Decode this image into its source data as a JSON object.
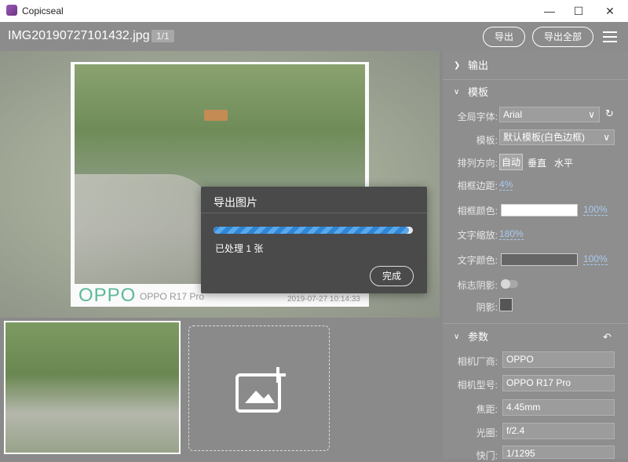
{
  "window": {
    "title": "Copicseal",
    "minimize": "—",
    "maximize": "☐",
    "close": "✕"
  },
  "toolbar": {
    "file_name": "IMG20190727101432.jpg",
    "page_indicator": "1/1",
    "export_label": "导出",
    "export_all_label": "导出全部"
  },
  "preview": {
    "brand_logo": "OPPO",
    "camera_model": "OPPO R17 Pro",
    "date": "2019-07-27 10:14:33"
  },
  "panel": {
    "output_section": "输出",
    "template_section": "模板",
    "global_font_label": "全局字体:",
    "global_font_value": "Arial",
    "template_label": "模板:",
    "template_value": "默认模板(白色边框)",
    "layout_direction_label": "排列方向:",
    "layout_options": [
      "自动",
      "垂直",
      "水平"
    ],
    "frame_margin_label": "相框边距:",
    "frame_margin_value": "4%",
    "frame_color_label": "相框颜色:",
    "frame_color_value": "#ffffff",
    "frame_opacity": "100%",
    "text_scale_label": "文字缩放:",
    "text_scale_value": "180%",
    "text_color_label": "文字颜色:",
    "text_color_value": "#666666",
    "text_opacity": "100%",
    "logo_shadow_label": "标志阴影:",
    "shadow_label": "阴影:",
    "params_section": "参数",
    "camera_maker_label": "相机厂商:",
    "camera_maker_value": "OPPO",
    "camera_model_label": "相机型号:",
    "camera_model_value": "OPPO R17 Pro",
    "focal_label": "焦距:",
    "focal_value": "4.45mm",
    "aperture_label": "光圈:",
    "aperture_value": "f/2.4",
    "shutter_label": "快门:",
    "shutter_value": "1/1295"
  },
  "dialog": {
    "title": "导出图片",
    "progress": 0.98,
    "status": "已处理 1 张",
    "done_label": "完成"
  }
}
